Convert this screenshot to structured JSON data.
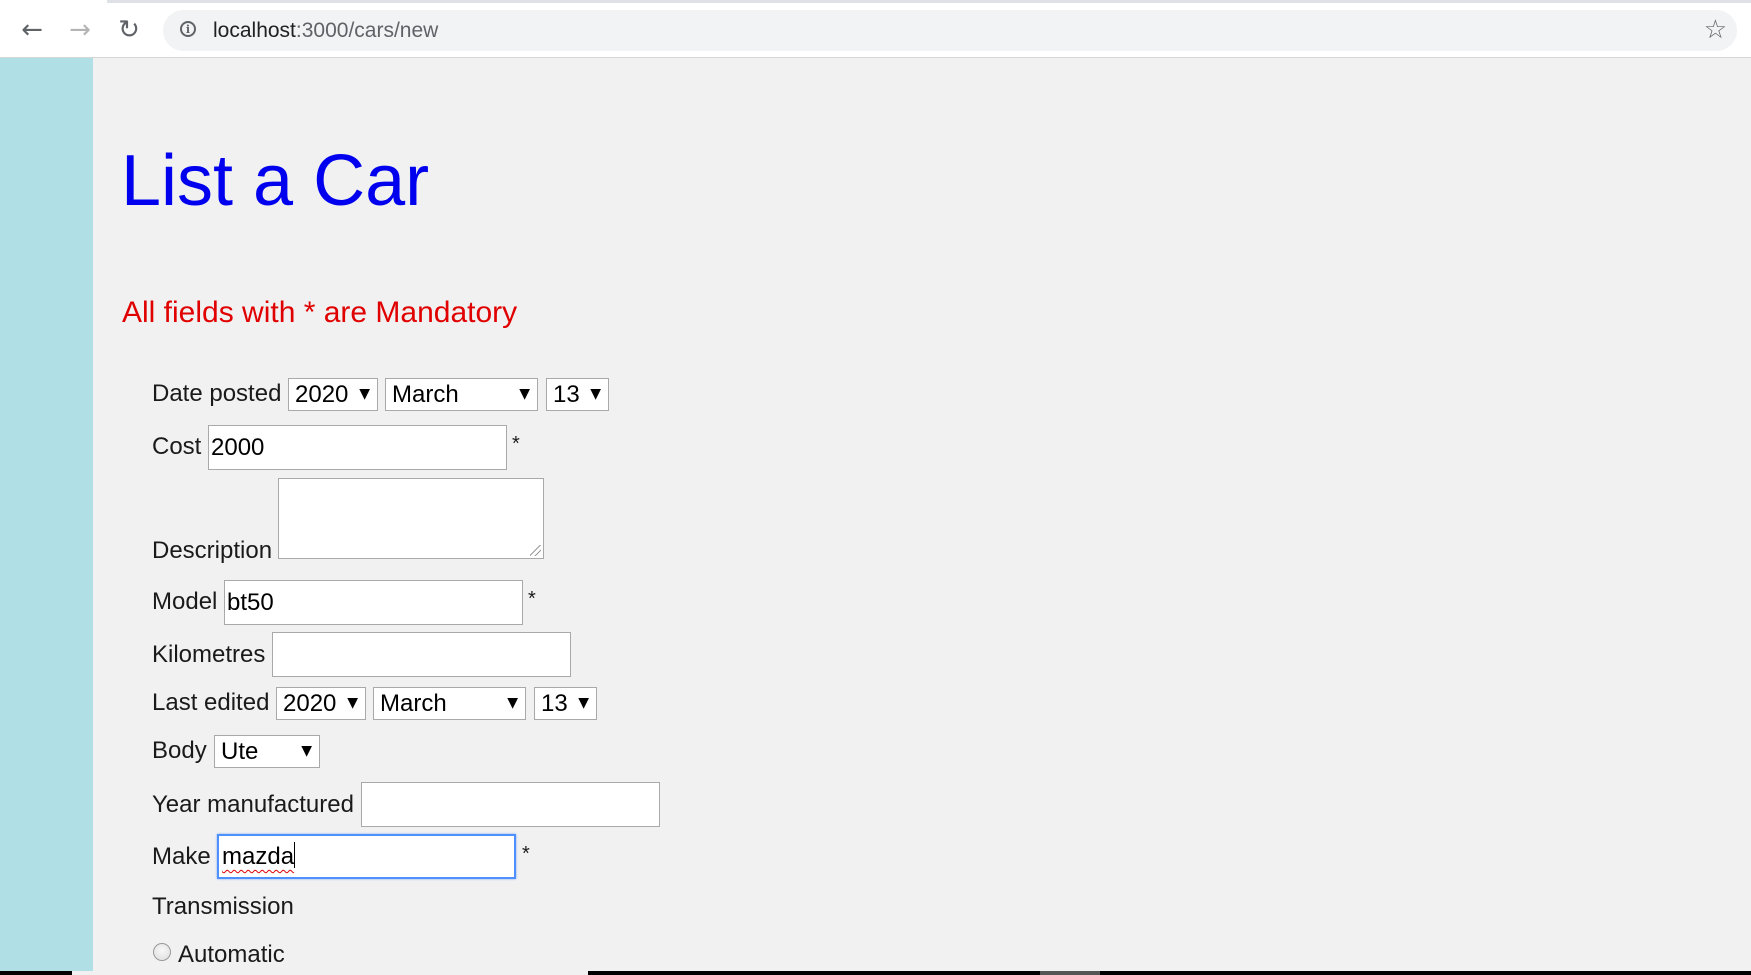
{
  "browser": {
    "url_host": "localhost",
    "url_path": ":3000/cars/new",
    "back_icon": "arrow-left-icon",
    "forward_icon": "arrow-right-icon",
    "reload_icon": "reload-icon",
    "info_icon": "info-icon",
    "bookmark_icon": "star-icon"
  },
  "page": {
    "title": "List a Car",
    "mandatory_note": "All fields with * are Mandatory",
    "title_color": "#0000ee",
    "note_color": "#e00000",
    "side_band_color": "#b0dfe5"
  },
  "form": {
    "date_posted": {
      "label": "Date posted",
      "year": "2020",
      "month": "March",
      "day": "13"
    },
    "cost": {
      "label": "Cost",
      "value": "2000",
      "required_mark": "*"
    },
    "description": {
      "label": "Description",
      "value": ""
    },
    "model": {
      "label": "Model",
      "value": "bt50",
      "required_mark": "*"
    },
    "kilometres": {
      "label": "Kilometres",
      "value": ""
    },
    "last_edited": {
      "label": "Last edited",
      "year": "2020",
      "month": "March",
      "day": "13"
    },
    "body": {
      "label": "Body",
      "value": "Ute"
    },
    "year_manufactured": {
      "label": "Year manufactured",
      "value": ""
    },
    "make": {
      "label": "Make",
      "value": "mazda",
      "required_mark": "*"
    },
    "transmission": {
      "label": "Transmission",
      "options": [
        {
          "label": "Automatic",
          "selected": false
        }
      ]
    }
  }
}
